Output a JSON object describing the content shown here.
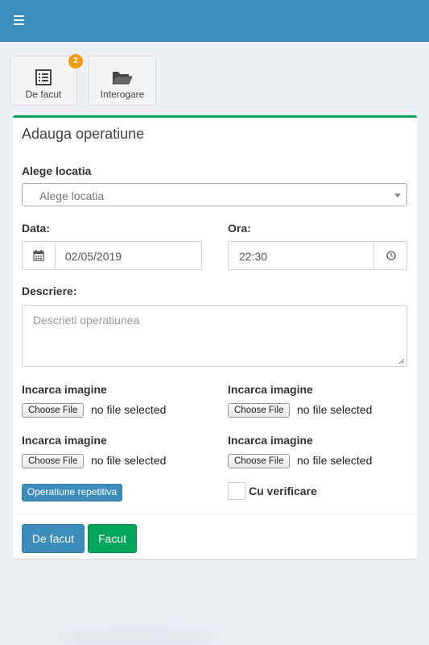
{
  "header": {
    "menu_icon": "hamburger-icon",
    "color": "#3c8dbc"
  },
  "tiles": [
    {
      "label": "De facut",
      "icon": "list-icon",
      "badge": "2"
    },
    {
      "label": "Interogare",
      "icon": "folder-open-icon"
    }
  ],
  "form": {
    "title": "Adauga operatiune",
    "location": {
      "label": "Alege locatia",
      "placeholder": "Alege locatia"
    },
    "date": {
      "label": "Data:",
      "value": "02/05/2019"
    },
    "time": {
      "label": "Ora:",
      "value": "22:30"
    },
    "description": {
      "label": "Descriere:",
      "placeholder": "Descrieti operatiunea"
    },
    "uploads": [
      {
        "label": "Incarca imagine",
        "button": "Choose File",
        "status": "no file selected"
      },
      {
        "label": "Incarca imagine",
        "button": "Choose File",
        "status": "no file selected"
      },
      {
        "label": "Incarca imagine",
        "button": "Choose File",
        "status": "no file selected"
      },
      {
        "label": "Incarca imagine",
        "button": "Choose File",
        "status": "no file selected"
      }
    ],
    "repeat_button": "Operatiune repetitiva",
    "verify_checkbox": {
      "label": "Cu verificare",
      "checked": false
    }
  },
  "footer": {
    "todo_button": "De facut",
    "done_button": "Facut"
  },
  "colors": {
    "primary": "#3c8dbc",
    "success": "#00a65a",
    "badge": "#f39c12",
    "background": "#ecf0f5"
  }
}
